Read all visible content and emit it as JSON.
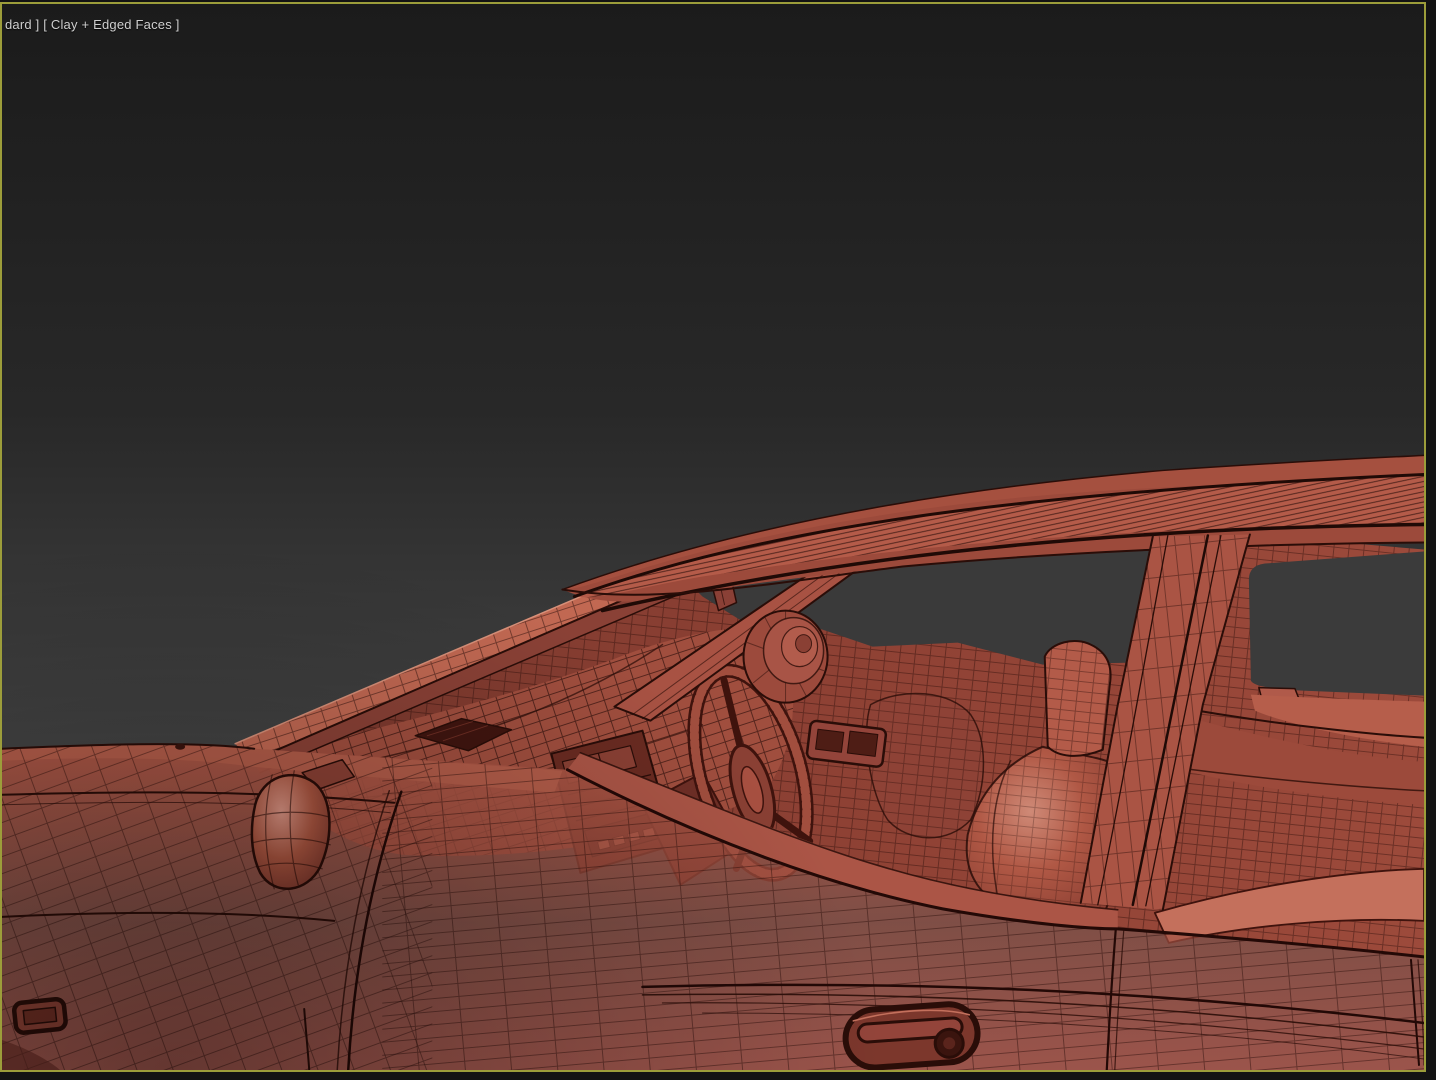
{
  "viewport": {
    "shading_label": "dard ] [ Clay + Edged Faces ]",
    "mode": "clay-edged-faces",
    "active": true
  },
  "colors": {
    "border": "#9c9d3a",
    "bg_top": "#1b1b1b",
    "bg_bottom": "#4b4b4b",
    "frame_outside": "#131313",
    "label_text": "#cfcfcf",
    "clay_base": "#a04e3f",
    "clay_light": "#b45b49",
    "clay_highlight": "#d8907e",
    "clay_shadow": "#6e2e24",
    "wireframe": "#2a0d08",
    "window_opening": "#3a3a3a"
  },
  "scene": {
    "object": "car-clay-wireframe-model",
    "view": "driver-side-interior-three-quarter",
    "parts": [
      "roof-rail",
      "a-pillar",
      "b-pillar",
      "windshield-frame",
      "front-window-opening",
      "rear-window-opening",
      "dashboard",
      "defroster-vent",
      "center-console",
      "steering-wheel",
      "steering-column",
      "rearview-mirror",
      "sun-visor",
      "wing-mirror",
      "front-seat-headrest",
      "front-seatback",
      "rear-seat",
      "rear-parcel-shelf",
      "door-inner-panel",
      "window-switch-bezel",
      "beltline",
      "front-door-seam",
      "door-handle",
      "lock-cylinder",
      "side-marker-lamp",
      "hood",
      "fender"
    ]
  }
}
